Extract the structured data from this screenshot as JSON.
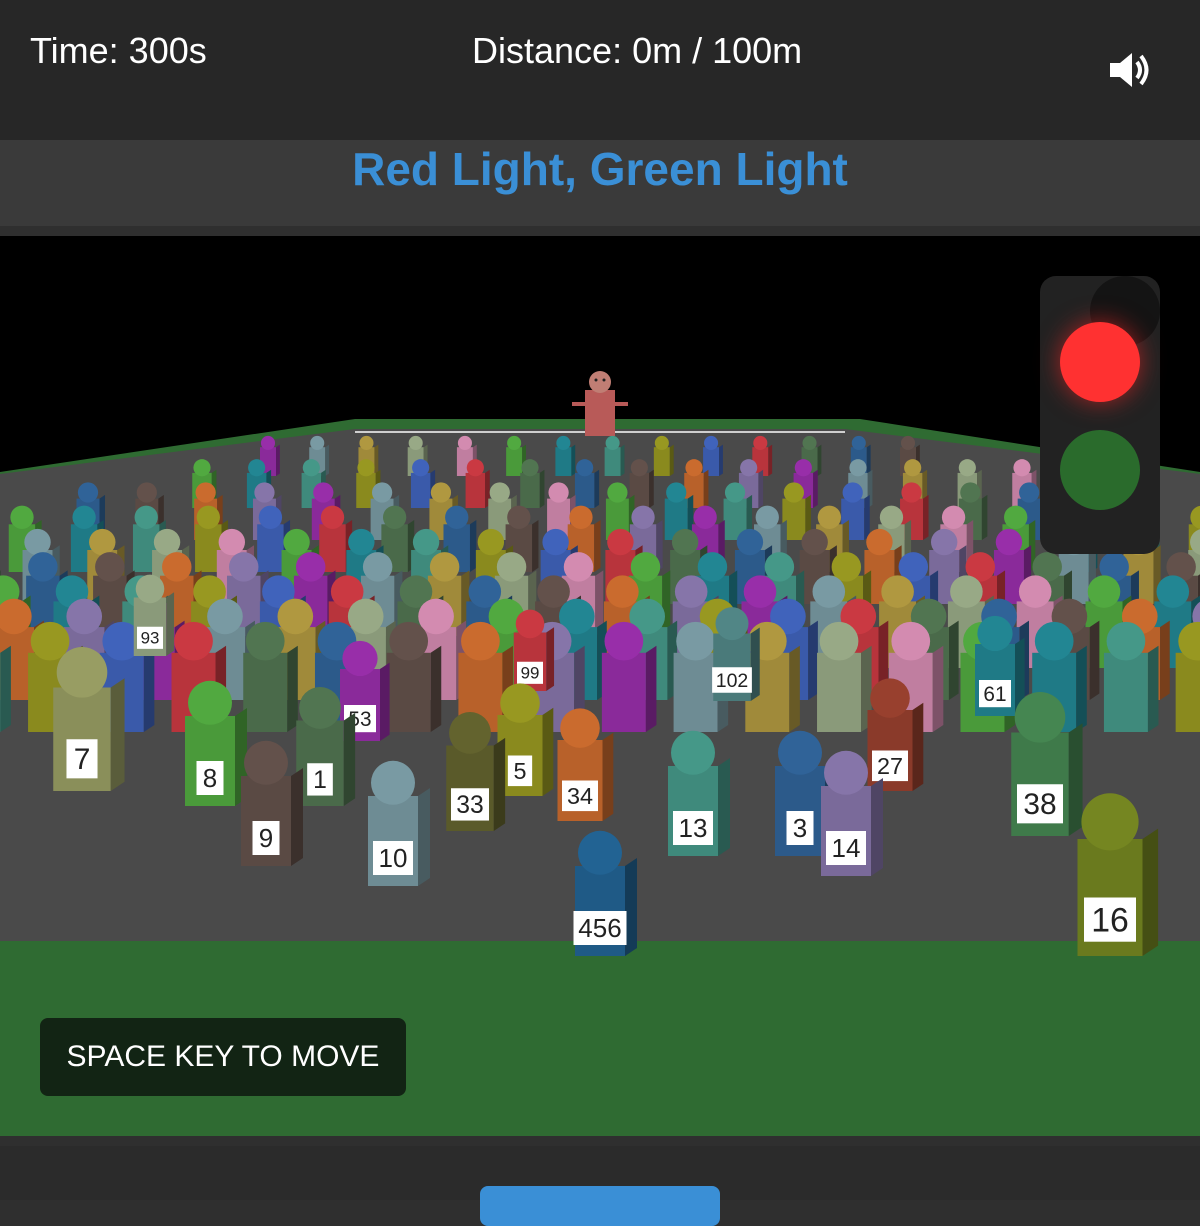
{
  "hud": {
    "time_label": "Time: 300s",
    "distance_label": "Distance: 0m / 100m",
    "sound_icon": "speaker-volume-icon"
  },
  "title": "Red Light, Green Light",
  "traffic_light": {
    "state": "red",
    "red_color": "#ff3131",
    "green_color": "#2a6b2c"
  },
  "players": [
    {
      "num": "456",
      "color": "#1f5a86"
    },
    {
      "num": "7",
      "color": "#8a8f5a"
    },
    {
      "num": "8",
      "color": "#4a9a3a"
    },
    {
      "num": "9",
      "color": "#5a4a44"
    },
    {
      "num": "10",
      "color": "#6e8c94"
    },
    {
      "num": "33",
      "color": "#5a5a2a"
    },
    {
      "num": "5",
      "color": "#8a8a1e"
    },
    {
      "num": "34",
      "color": "#b8612a"
    },
    {
      "num": "13",
      "color": "#3f8a7c"
    },
    {
      "num": "3",
      "color": "#2c5a8a"
    },
    {
      "num": "14",
      "color": "#7a6a9a"
    },
    {
      "num": "38",
      "color": "#3f7a4a"
    },
    {
      "num": "16",
      "color": "#6a7a1e"
    },
    {
      "num": "1",
      "color": "#4a6a4a"
    },
    {
      "num": "53",
      "color": "#8a2a9a"
    },
    {
      "num": "99",
      "color": "#b8343c"
    },
    {
      "num": "102",
      "color": "#4a7a7a"
    },
    {
      "num": "61",
      "color": "#1f7a86"
    },
    {
      "num": "93",
      "color": "#8a9a7a"
    },
    {
      "num": "27",
      "color": "#8a3a2a"
    }
  ],
  "hint": "SPACE KEY TO MOVE",
  "colors": {
    "accent": "#3a8fd6",
    "field": "#2f6b32",
    "ground": "#4a4a4a"
  }
}
